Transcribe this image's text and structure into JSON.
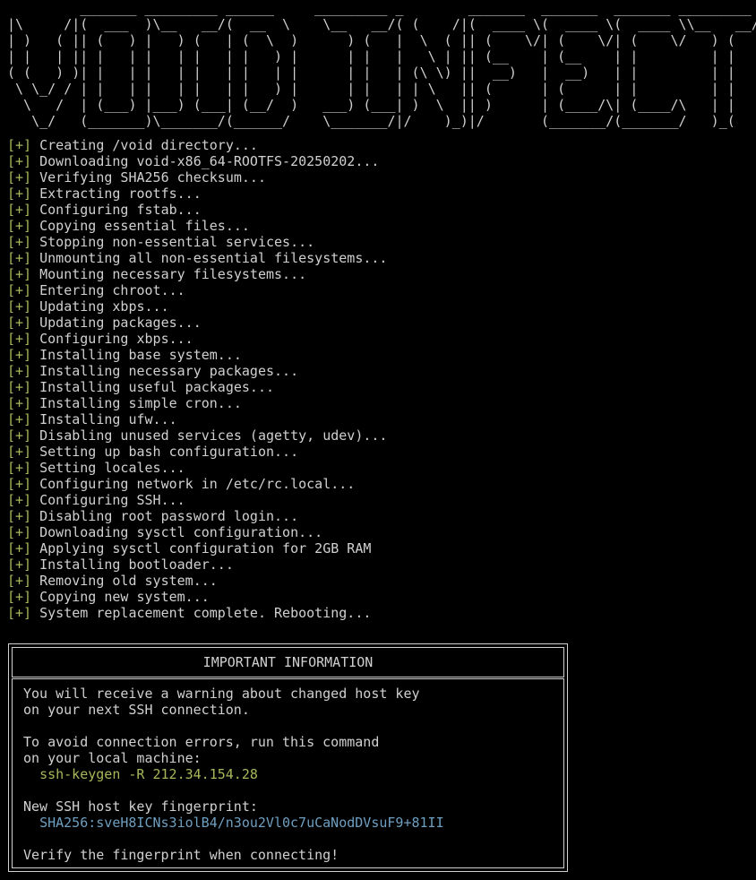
{
  "banner": {
    "ascii_art": "         _______ _________ ______     _________ _        _______  _______  _______ _________\n|\\     /|(  ___  )\\__   __/(  __  \\    \\__   __/( (    /|(  ____ \\(  ____ \\(  ____ \\\\__   __/\n| )   ( || (   ) |   ) (   | (  \\  )      ) (   |  \\  ( || (    \\/| (    \\/| (    \\/   ) (   \n| |   | || |   | |   | |   | |   ) |      | |   |   \\ | || (__    | (__    | |         | |   \n( (   ) )| |   | |   | |   | |   | |      | |   | (\\ \\) ||  __)   |  __)   | |         | |   \n \\ \\_/ / | |   | |   | |   | |   ) |      | |   | | \\   || (      | (      | |         | |   \n  \\   /  | (___) |___) (___| (__/  )   ___) (___| )  \\  || )      | (____/\\| (____/\\   | |   \n   \\_/   (_______)\\_______/(______/    \\_______/|/    )_)|/       (_______/(_______/   )_(   "
  },
  "log": {
    "prefix": "[+]",
    "lines": [
      "Creating /void directory...",
      "Downloading void-x86_64-ROOTFS-20250202...",
      "Verifying SHA256 checksum...",
      "Extracting rootfs...",
      "Configuring fstab...",
      "Copying essential files...",
      "Stopping non-essential services...",
      "Unmounting all non-essential filesystems...",
      "Mounting necessary filesystems...",
      "Entering chroot...",
      "Updating xbps...",
      "Updating packages...",
      "Configuring xbps...",
      "Installing base system...",
      "Installing necessary packages...",
      "Installing useful packages...",
      "Installing simple cron...",
      "Installing ufw...",
      "Disabling unused services (agetty, udev)...",
      "Setting up bash configuration...",
      "Setting locales...",
      "Configuring network in /etc/rc.local...",
      "Configuring SSH...",
      "Disabling root password login...",
      "Downloading sysctl configuration...",
      "Applying sysctl configuration for 2GB RAM",
      "Installing bootloader...",
      "Removing old system...",
      "Copying new system...",
      "System replacement complete. Rebooting..."
    ]
  },
  "info": {
    "title": "IMPORTANT INFORMATION",
    "warning_line1": "You will receive a warning about changed host key",
    "warning_line2": "on your next SSH connection.",
    "avoid_line1": "To avoid connection errors, run this command",
    "avoid_line2": "on your local machine:",
    "command": "ssh-keygen -R 212.34.154.28",
    "fingerprint_label": "New SSH host key fingerprint:",
    "fingerprint": "SHA256:sveH8ICNs3iolB4/n3ou2Vl0c7uCaNodDVsuF9+81II",
    "verify_line": "Verify the fingerprint when connecting!"
  },
  "colors": {
    "background": "#000000",
    "text": "#d0d0d0",
    "prefix": "#a6b85a",
    "command": "#a6b85a",
    "fingerprint": "#6f9fc0"
  }
}
